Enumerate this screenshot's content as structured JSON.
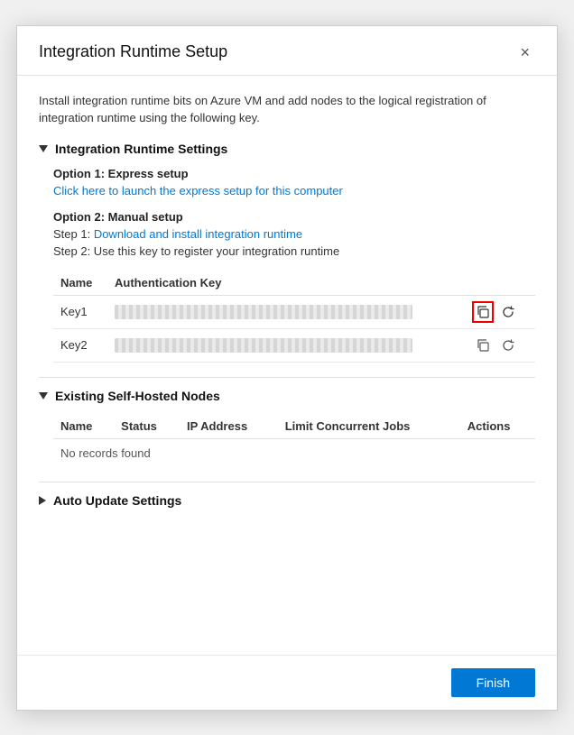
{
  "modal": {
    "title": "Integration Runtime Setup",
    "close_label": "×",
    "intro": "Install integration runtime bits on Azure VM and add nodes to the logical registration of integration runtime using the following key."
  },
  "sections": {
    "runtime_settings": {
      "title": "Integration Runtime Settings",
      "expanded": true,
      "option1": {
        "label": "Option 1: Express setup",
        "link_text": "Click here to launch the express setup for this computer"
      },
      "option2": {
        "label": "Option 2: Manual setup",
        "step1_prefix": "Step 1: ",
        "step1_link": "Download and install integration runtime",
        "step2": "Step 2: Use this key to register your integration runtime"
      },
      "table": {
        "col_name": "Name",
        "col_auth_key": "Authentication Key",
        "rows": [
          {
            "name": "Key1",
            "key_value": ""
          },
          {
            "name": "Key2",
            "key_value": ""
          }
        ]
      }
    },
    "existing_nodes": {
      "title": "Existing Self-Hosted Nodes",
      "expanded": true,
      "columns": [
        "Name",
        "Status",
        "IP Address",
        "Limit Concurrent Jobs",
        "Actions"
      ],
      "no_records": "No records found"
    },
    "auto_update": {
      "title": "Auto Update Settings",
      "expanded": false
    }
  },
  "footer": {
    "finish_label": "Finish"
  }
}
